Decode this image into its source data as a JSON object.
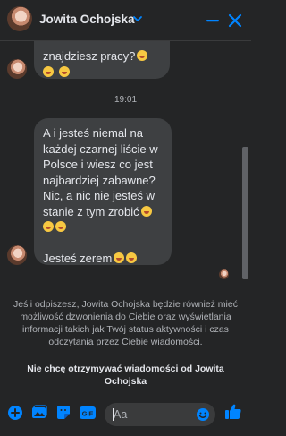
{
  "header": {
    "contact_name": "Jowita Ochojska"
  },
  "messages": {
    "bubble1_lines": [
      "znajdziesz pracy?",
      ""
    ],
    "timestamp": "19:01",
    "bubble2_text": [
      "A i jesteś niemal na",
      "każdej czarnej liście w",
      "Polsce i wiesz co jest",
      "najbardziej zabawne?",
      "Nic, a nic nie jesteś w",
      "stanie z tym zrobić"
    ],
    "bubble2_last": "Jesteś zerem"
  },
  "notice": {
    "text": "Jeśli odpiszesz, Jowita Ochojska będzie również mieć możliwość dzwonienia do Ciebie oraz wyświetlania informacji takich jak Twój status aktywności i czas odczytania przez Ciebie wiadomości.",
    "link": "Nie chcę otrzymywać wiadomości od Jowita Ochojska"
  },
  "composer": {
    "placeholder": "Aa"
  },
  "colors": {
    "accent": "#0084ff",
    "background": "#242526",
    "bubble": "#3e4042"
  },
  "icons": [
    "plus-circle-icon",
    "photo-icon",
    "sticker-icon",
    "gif-icon",
    "emoji-icon",
    "like-thumb-icon",
    "chevron-down-icon",
    "minimize-icon",
    "close-icon"
  ]
}
